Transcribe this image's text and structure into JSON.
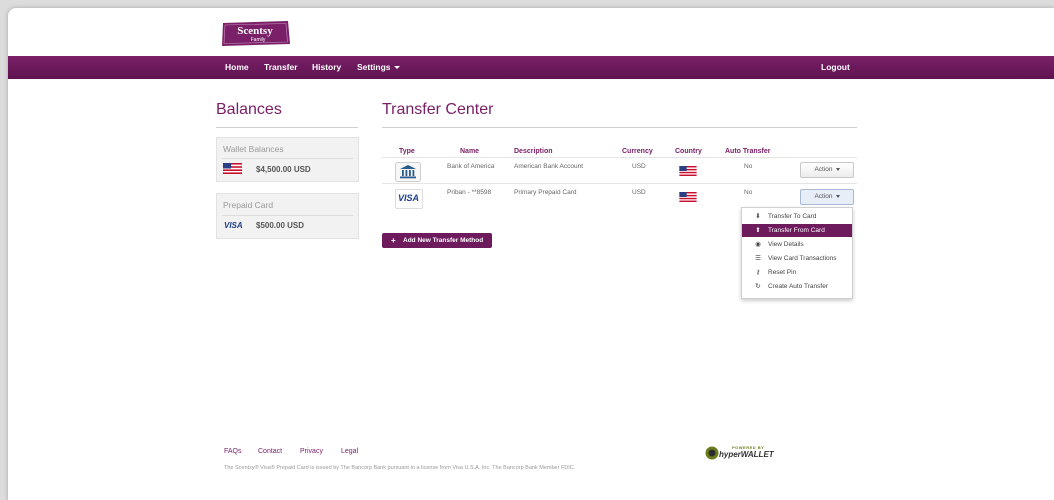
{
  "brand": {
    "logo_text": "Scentsy",
    "logo_subtext": "Family",
    "color_primary": "#6d1b5d"
  },
  "nav": {
    "items": [
      "Home",
      "Transfer",
      "History",
      "Settings"
    ],
    "logout": "Logout"
  },
  "balances": {
    "title": "Balances",
    "wallet": {
      "title": "Wallet Balances",
      "amount": "$4,500.00 USD",
      "icon": "us-flag-icon"
    },
    "prepaid": {
      "title": "Prepaid Card",
      "amount": "$500.00 USD",
      "icon": "visa-icon"
    }
  },
  "transfer": {
    "title": "Transfer Center",
    "columns": [
      "Type",
      "Name",
      "Description",
      "Currency",
      "Country",
      "Auto Transfer"
    ],
    "rows": [
      {
        "type_icon": "bank-icon",
        "name": "Bank of America",
        "description": "American Bank Account",
        "currency": "USD",
        "country_icon": "us-flag-icon",
        "auto_transfer": "No",
        "action": "Action"
      },
      {
        "type_icon": "visa-icon",
        "name": "Priban - **8598",
        "description": "Primary Prepaid Card",
        "currency": "USD",
        "country_icon": "us-flag-icon",
        "auto_transfer": "No",
        "action": "Action"
      }
    ],
    "add_button": "Add New Transfer Method",
    "visa_text": "VISA"
  },
  "action_menu": {
    "items": [
      {
        "label": "Transfer To Card",
        "icon": "download-icon"
      },
      {
        "label": "Transfer From Card",
        "icon": "upload-icon",
        "active": true
      },
      {
        "label": "View Details",
        "icon": "eye-icon"
      },
      {
        "label": "View Card Transactions",
        "icon": "list-icon"
      },
      {
        "label": "Reset Pin",
        "icon": "key-icon"
      },
      {
        "label": "Create Auto Transfer",
        "icon": "refresh-icon"
      }
    ]
  },
  "footer": {
    "links": [
      "FAQs",
      "Contact",
      "Privacy",
      "Legal"
    ],
    "disclaimer": "The Scentsy® Visa® Prepaid Card is issued by The Bancorp Bank pursuant to a license from Visa U.S.A. Inc. The Bancorp Bank Member FDIC.",
    "powered_by": "POWERED BY",
    "hyperwallet": "hyperWALLET"
  }
}
